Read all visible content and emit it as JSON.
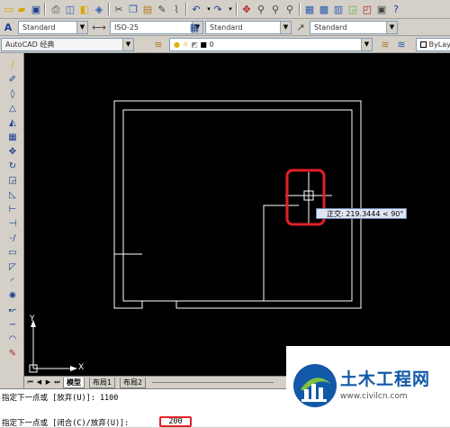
{
  "app": {
    "name": "AutoCAD"
  },
  "toolbar_row1": {
    "icons": [
      "folder-icon",
      "save-icon",
      "print-icon",
      "print-preview-icon",
      "publish-icon",
      "plot-icon",
      "cut-icon",
      "copy-icon",
      "paste-icon",
      "match-properties-icon",
      "undo-icon",
      "redo-icon",
      "pan-icon",
      "zoom-realtime-icon",
      "zoom-window-icon",
      "zoom-previous-icon",
      "properties-icon",
      "design-center-icon",
      "tool-palettes-icon",
      "sheet-set-icon",
      "markup-icon",
      "calculator-icon",
      "help-icon"
    ]
  },
  "toolbar_row2": {
    "text_style": "Standard",
    "dim_style": "ISO-25",
    "table_style": "Standard",
    "multileader_style": "Standard"
  },
  "toolbar_row3": {
    "workspace": "AutoCAD 经典",
    "layer_name": "0",
    "color_control": "ByLay"
  },
  "drawing": {
    "tooltip_label": "正交",
    "tooltip_value": "219.3444 < 90°",
    "ucs_x": "X",
    "ucs_y": "Y"
  },
  "tabs": {
    "model": "模型",
    "layout1": "布局1",
    "layout2": "布局2"
  },
  "command_line": {
    "line1": "指定下一点或 [放弃(U)]: 1100",
    "line2": "指定下一点或 [闭合(C)/放弃(U)]:",
    "input_value": "200"
  },
  "watermark": {
    "title": "土木工程网",
    "url": "www.civilcn.com"
  }
}
